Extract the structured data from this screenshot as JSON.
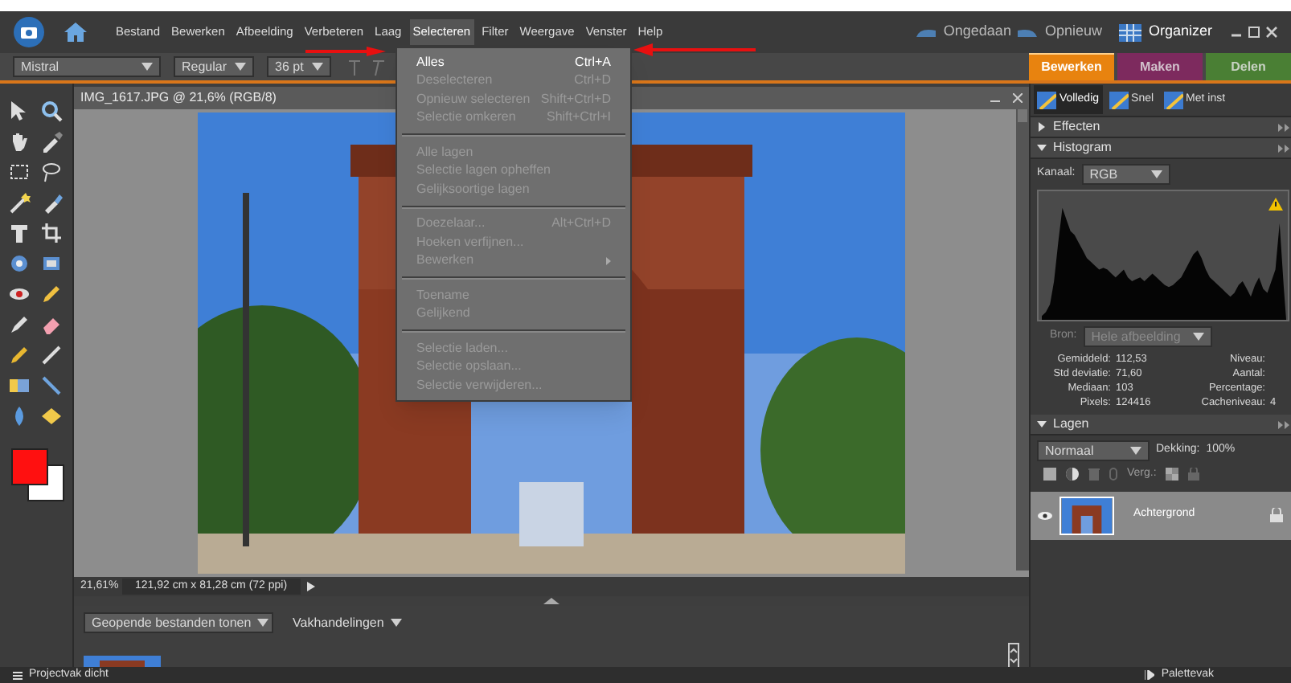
{
  "menu_bar": {
    "items": [
      {
        "label": "Bestand",
        "selected": false
      },
      {
        "label": "Bewerken",
        "selected": false
      },
      {
        "label": "Afbeelding",
        "selected": false
      },
      {
        "label": "Verbeteren",
        "selected": false
      },
      {
        "label": "Laag",
        "selected": false
      },
      {
        "label": "Selecteren",
        "selected": true
      },
      {
        "label": "Filter",
        "selected": false
      },
      {
        "label": "Weergave",
        "selected": false
      },
      {
        "label": "Venster",
        "selected": false
      },
      {
        "label": "Help",
        "selected": false
      }
    ],
    "undo": "Ongedaan",
    "redo": "Opnieuw",
    "organizer": "Organizer"
  },
  "options_bar": {
    "font": "Mistral",
    "style": "Regular",
    "size": "36 pt"
  },
  "panel_tabs": [
    {
      "label": "Bewerken",
      "selected": true,
      "color": "#e8830f"
    },
    {
      "label": "Maken",
      "selected": false,
      "color": "#7d2a5e"
    },
    {
      "label": "Delen",
      "selected": false,
      "color": "#4a7f34"
    }
  ],
  "dropdown_menu": {
    "groups": [
      [
        {
          "label": "Alles",
          "shortcut": "Ctrl+A",
          "disabled": false
        },
        {
          "label": "Deselecteren",
          "shortcut": "Ctrl+D",
          "disabled": true
        },
        {
          "label": "Opnieuw selecteren",
          "shortcut": "Shift+Ctrl+D",
          "disabled": true
        },
        {
          "label": "Selectie omkeren",
          "shortcut": "Shift+Ctrl+I",
          "disabled": true
        }
      ],
      [
        {
          "label": "Alle lagen",
          "disabled": true
        },
        {
          "label": "Selectie lagen opheffen",
          "disabled": true
        },
        {
          "label": "Gelijksoortige lagen",
          "disabled": true
        }
      ],
      [
        {
          "label": "Doezelaar...",
          "shortcut": "Alt+Ctrl+D",
          "disabled": true
        },
        {
          "label": "Hoeken verfijnen...",
          "disabled": true
        },
        {
          "label": "Bewerken",
          "disabled": true,
          "submenu": true
        }
      ],
      [
        {
          "label": "Toename",
          "disabled": true
        },
        {
          "label": "Gelijkend",
          "disabled": true
        }
      ],
      [
        {
          "label": "Selectie laden...",
          "disabled": true
        },
        {
          "label": "Selectie opslaan...",
          "disabled": true
        },
        {
          "label": "Selectie verwijderen...",
          "disabled": true
        }
      ]
    ]
  },
  "document": {
    "title": "IMG_1617.JPG @ 21,6% (RGB/8)",
    "zoom": "21,61%",
    "dimensions": "121,92 cm x 81,28 cm (72 ppi)"
  },
  "project_bin": {
    "show": "Geopende bestanden tonen",
    "actions": "Vakhandelingen"
  },
  "modes": [
    {
      "label": "Volledig",
      "selected": true
    },
    {
      "label": "Snel",
      "selected": false
    },
    {
      "label": "Met inst",
      "selected": false
    }
  ],
  "panels": {
    "effects": {
      "title": "Effecten",
      "expanded": false
    },
    "histogram": {
      "title": "Histogram",
      "expanded": true,
      "channel_label": "Kanaal:",
      "channel": "RGB",
      "source_label": "Bron:",
      "source": "Hele afbeelding",
      "stats_left": [
        {
          "label": "Gemiddeld:",
          "value": "112,53"
        },
        {
          "label": "Std deviatie:",
          "value": "71,60"
        },
        {
          "label": "Mediaan:",
          "value": "103"
        },
        {
          "label": "Pixels:",
          "value": "124416"
        }
      ],
      "stats_right": [
        {
          "label": "Niveau:"
        },
        {
          "label": "Aantal:"
        },
        {
          "label": "Percentage:"
        },
        {
          "label": "Cacheniveau:",
          "value": "4"
        }
      ]
    },
    "layers": {
      "title": "Lagen",
      "expanded": true,
      "blend_mode": "Normaal",
      "opacity_label": "Dekking:",
      "opacity": "100%",
      "lock_label": "Verg.:",
      "items": [
        {
          "name": "Achtergrond",
          "visible": true,
          "locked": true,
          "selected": true
        }
      ]
    }
  },
  "status_bar": {
    "left": "Projectvak dicht",
    "right": "Palettevak"
  }
}
